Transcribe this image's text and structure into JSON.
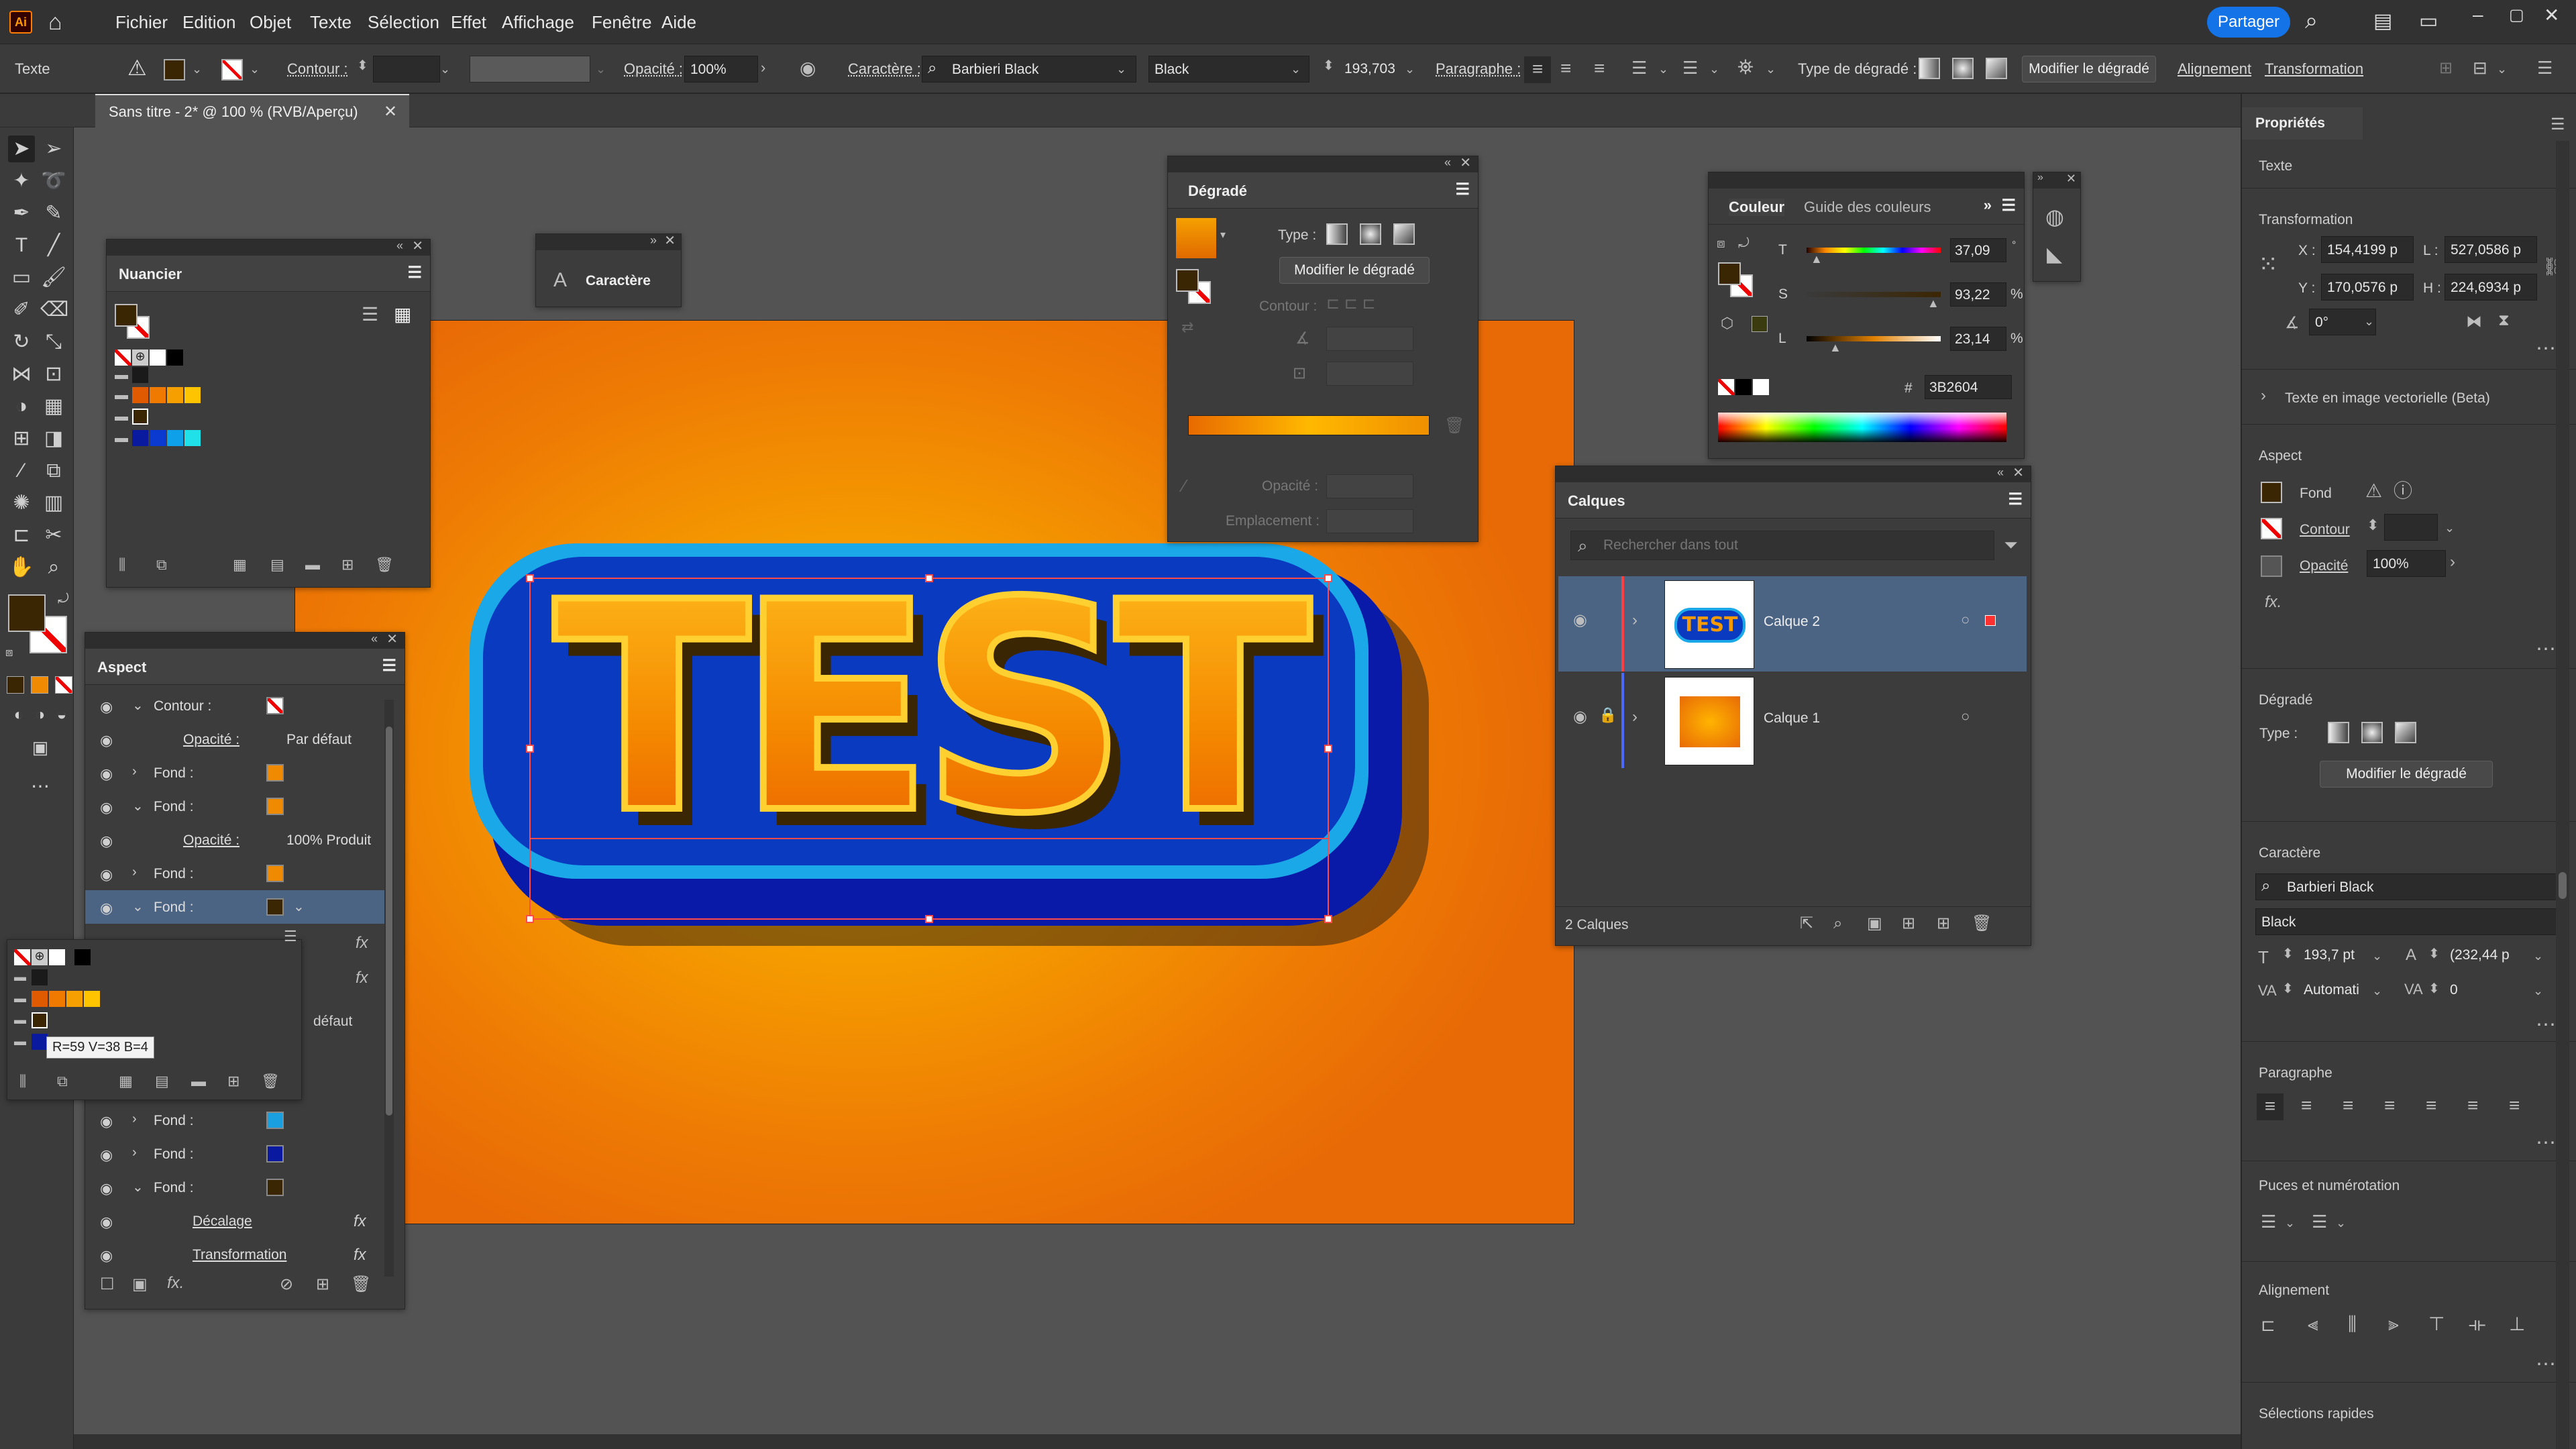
{
  "app": {
    "logo": "Ai",
    "title": "Sans titre - 2* @ 100 % (RVB/Aperçu)",
    "share": "Partager"
  },
  "menu": [
    "Fichier",
    "Edition",
    "Objet",
    "Texte",
    "Sélection",
    "Effet",
    "Affichage",
    "Fenêtre",
    "Aide"
  ],
  "control": {
    "type": "Texte",
    "contour": "Contour :",
    "opacite": "Opacité :",
    "opacite_val": "100%",
    "caractere": "Caractère :",
    "font": "Barbieri Black",
    "style": "Black",
    "size": "193,703",
    "paragraphe": "Paragraphe :",
    "grad_type": "Type de dégradé :",
    "modify_grad": "Modifier le dégradé",
    "alignement": "Alignement",
    "transformation": "Transformation"
  },
  "nuancier": {
    "title": "Nuancier",
    "colors": {
      "row1": [
        "#ffffff",
        "#000000"
      ],
      "row2": [
        "#1a1a1a"
      ],
      "row3": [
        "#e05a00",
        "#f07a00",
        "#f5a000",
        "#ffc400"
      ],
      "row4": [
        "#3b2604"
      ],
      "row5": [
        "#0a1a9e",
        "#0a3ad0",
        "#0ea0e8",
        "#20e0e8"
      ]
    }
  },
  "caractere_panel": {
    "title": "Caractère"
  },
  "aspect": {
    "title": "Aspect",
    "rows": [
      {
        "kind": "contour",
        "label": "Contour :"
      },
      {
        "kind": "sub",
        "label": "Opacité :",
        "value": "Par défaut"
      },
      {
        "kind": "fill",
        "label": "Fond :",
        "color": "#f08a00",
        "chev": "›"
      },
      {
        "kind": "fill",
        "label": "Fond :",
        "color": "#f08a00",
        "chev": "⌄"
      },
      {
        "kind": "sub",
        "label": "Opacité :",
        "value": "100% Produit"
      },
      {
        "kind": "fill",
        "label": "Fond :",
        "color": "#f08a00",
        "chev": "›"
      },
      {
        "kind": "fill",
        "label": "Fond :",
        "color": "#3b2604",
        "chev": "⌄"
      }
    ],
    "lower_rows": [
      {
        "kind": "fill",
        "label": "Fond :",
        "color": "#1aa0e0",
        "chev": "›"
      },
      {
        "kind": "fill",
        "label": "Fond :",
        "color": "#0a1aa0",
        "chev": "›"
      },
      {
        "kind": "fill",
        "label": "Fond :",
        "color": "#3b2604",
        "chev": "⌄"
      },
      {
        "kind": "fx",
        "label": "Décalage"
      },
      {
        "kind": "fx",
        "label": "Transformation"
      }
    ],
    "popup_default": "défaut",
    "tooltip": "R=59 V=38 B=4"
  },
  "degrade": {
    "title": "Dégradé",
    "type": "Type :",
    "modify": "Modifier le dégradé",
    "contour": "Contour :",
    "opacite": "Opacité :",
    "emplacement": "Emplacement :"
  },
  "couleur": {
    "tab1": "Couleur",
    "tab2": "Guide des couleurs",
    "T": "37,09",
    "S": "93,22",
    "L": "23,14",
    "hex_label": "#",
    "hex": "3B2604",
    "pct": "%"
  },
  "calques": {
    "title": "Calques",
    "search": "Rechercher dans tout",
    "layers": [
      {
        "name": "Calque 2"
      },
      {
        "name": "Calque 1"
      }
    ],
    "count": "2 Calques"
  },
  "props": {
    "title": "Propriétés",
    "kind": "Texte",
    "transformation": "Transformation",
    "x_label": "X :",
    "x": "154,4199 p",
    "y_label": "Y :",
    "y": "170,0576 p",
    "w_label": "L :",
    "w": "527,0586 p",
    "h_label": "H :",
    "h": "224,6934 p",
    "angle": "0°",
    "vector": "Texte en image vectorielle (Beta)",
    "aspect": "Aspect",
    "fond": "Fond",
    "contour": "Contour",
    "opacite": "Opacité",
    "opacite_val": "100%",
    "degrade": "Dégradé",
    "type": "Type :",
    "modify": "Modifier le dégradé",
    "caractere": "Caractère",
    "font": "Barbieri Black",
    "style": "Black",
    "size": "193,7 pt",
    "leading": "(232,44 p",
    "tracking": "Automati",
    "kerning": "0",
    "paragraphe": "Paragraphe",
    "puces": "Puces et numérotation",
    "alignement": "Alignement",
    "selections": "Sélections rapides"
  },
  "artwork": {
    "text": "TEST"
  }
}
